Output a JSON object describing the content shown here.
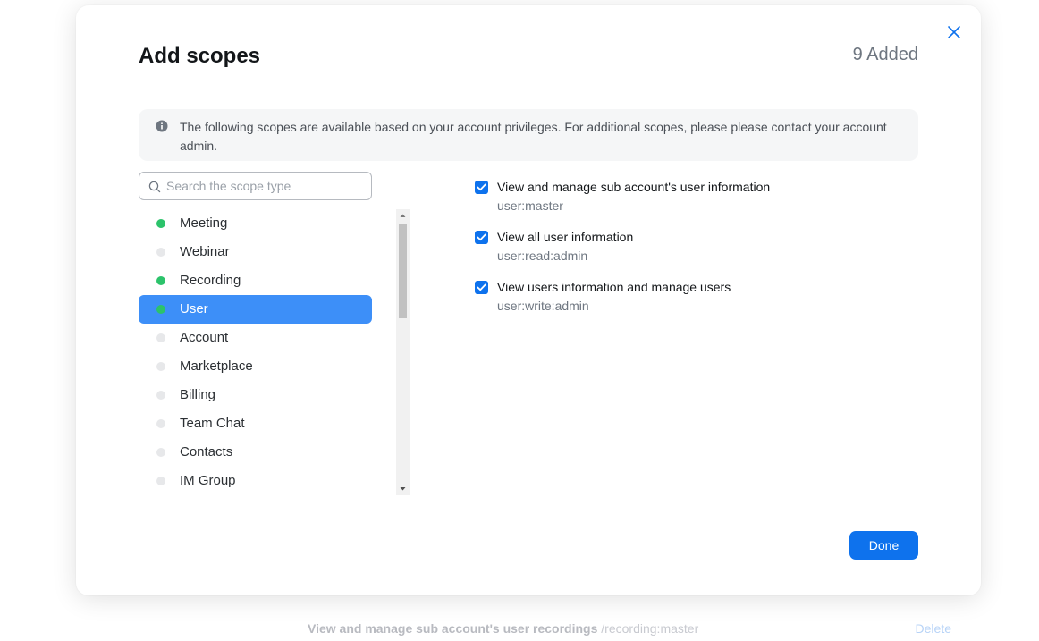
{
  "modal": {
    "title": "Add scopes",
    "added_count": "9 Added",
    "info_text": "The following scopes are available based on your account privileges. For additional scopes, please please contact your account admin.",
    "search": {
      "placeholder": "Search the scope type",
      "value": ""
    },
    "categories": [
      {
        "label": "Meeting",
        "has_selected": true
      },
      {
        "label": "Webinar",
        "has_selected": false
      },
      {
        "label": "Recording",
        "has_selected": true
      },
      {
        "label": "User",
        "has_selected": true,
        "active": true
      },
      {
        "label": "Account",
        "has_selected": false
      },
      {
        "label": "Marketplace",
        "has_selected": false
      },
      {
        "label": "Billing",
        "has_selected": false
      },
      {
        "label": "Team Chat",
        "has_selected": false
      },
      {
        "label": "Contacts",
        "has_selected": false
      },
      {
        "label": "IM Group",
        "has_selected": false
      }
    ],
    "scopes": [
      {
        "title": "View and manage sub account's user information",
        "key": "user:master",
        "checked": true
      },
      {
        "title": "View all user information",
        "key": "user:read:admin",
        "checked": true
      },
      {
        "title": "View users information and manage users",
        "key": "user:write:admin",
        "checked": true
      }
    ],
    "done_label": "Done"
  },
  "background": {
    "row_title": "View and manage sub account's user recordings",
    "row_scope": "/recording:master",
    "delete_label": "Delete"
  },
  "colors": {
    "accent": "#0e72ed",
    "active_item": "#3d8ff8",
    "selected_dot": "#2cc36b",
    "unselected_dot": "#e7e8ea"
  },
  "icons": {
    "close": "close-icon",
    "info": "info-icon",
    "search": "search-icon",
    "check": "check-icon"
  }
}
